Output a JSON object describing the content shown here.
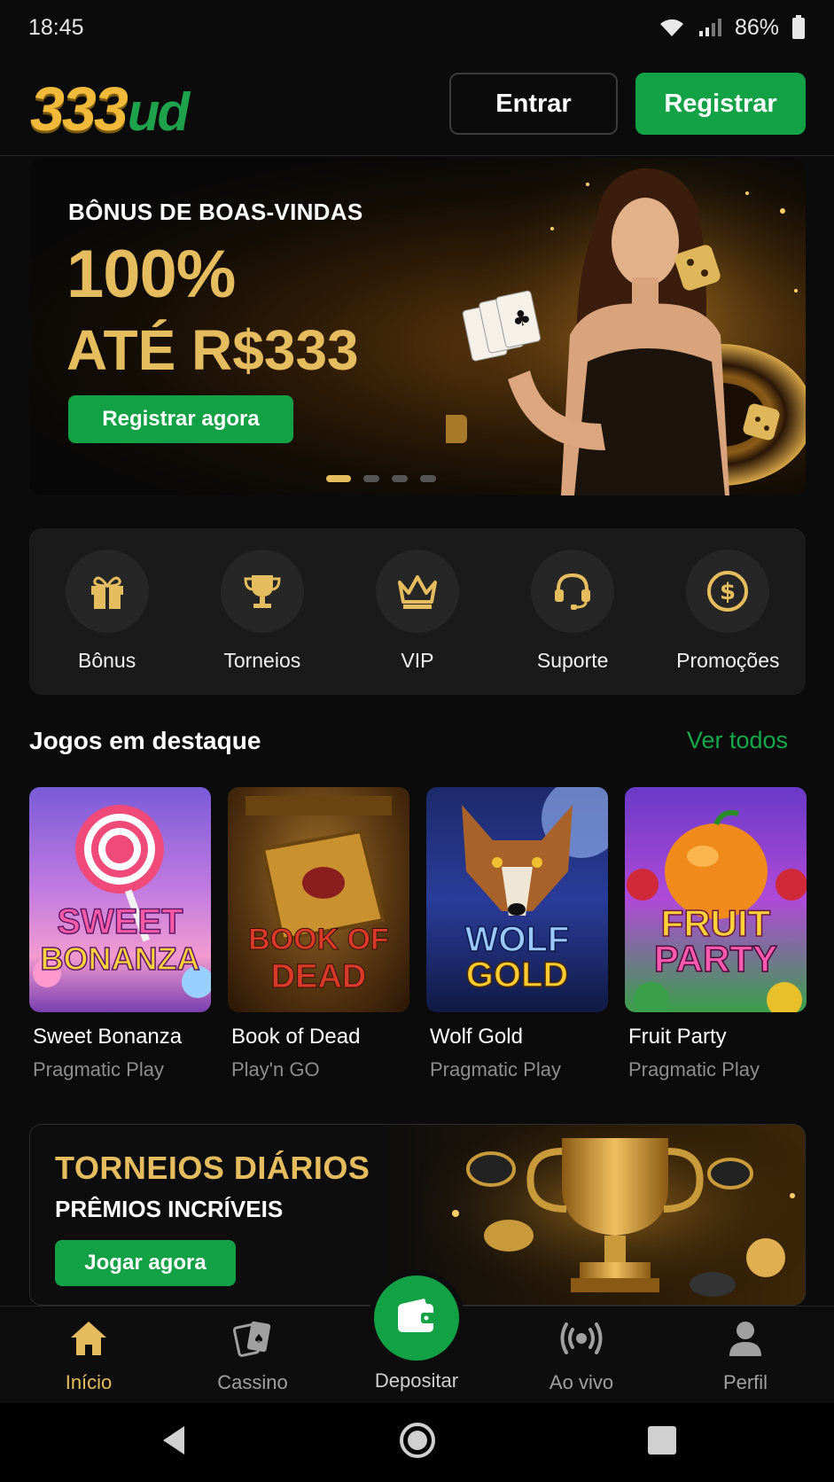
{
  "status_bar": {
    "time": "18:45",
    "battery": "86%"
  },
  "header": {
    "logo_number": "333",
    "logo_suffix": "ud",
    "login_label": "Entrar",
    "register_label": "Registrar"
  },
  "hero": {
    "subtitle": "BÔNUS DE BOAS-VINDAS",
    "percent": "100%",
    "amount": "ATÉ R$333",
    "cta": "Registrar agora",
    "slides_total": 4,
    "active_slide": 1
  },
  "quick_menu": [
    {
      "label": "Bônus",
      "icon": "gift-icon"
    },
    {
      "label": "Torneios",
      "icon": "trophy-icon"
    },
    {
      "label": "VIP",
      "icon": "crown-icon"
    },
    {
      "label": "Suporte",
      "icon": "headset-icon"
    },
    {
      "label": "Promoções",
      "icon": "dollar-coin-icon"
    }
  ],
  "featured": {
    "title": "Jogos em destaque",
    "see_all": "Ver todos",
    "games": [
      {
        "name": "Sweet Bonanza",
        "provider": "Pragmatic Play",
        "art_line1": "SWEET",
        "art_line2": "BONANZA"
      },
      {
        "name": "Book of Dead",
        "provider": "Play'n GO",
        "art_line1": "BOOK OF",
        "art_line2": "DEAD"
      },
      {
        "name": "Wolf Gold",
        "provider": "Pragmatic Play",
        "art_line1": "WOLF",
        "art_line2": "GOLD"
      },
      {
        "name": "Fruit Party",
        "provider": "Pragmatic Play",
        "art_line1": "FRUIT",
        "art_line2": "PARTY"
      }
    ]
  },
  "tournament": {
    "title": "TORNEIOS DIÁRIOS",
    "subtitle": "PRÊMIOS INCRÍVEIS",
    "cta": "Jogar agora"
  },
  "bottom_nav": {
    "home": "Início",
    "casino": "Cassino",
    "deposit": "Depositar",
    "live": "Ao vivo",
    "profile": "Perfil"
  },
  "colors": {
    "accent_gold": "#e6bd5e",
    "accent_green": "#12a144",
    "background": "#0b0b0b"
  }
}
